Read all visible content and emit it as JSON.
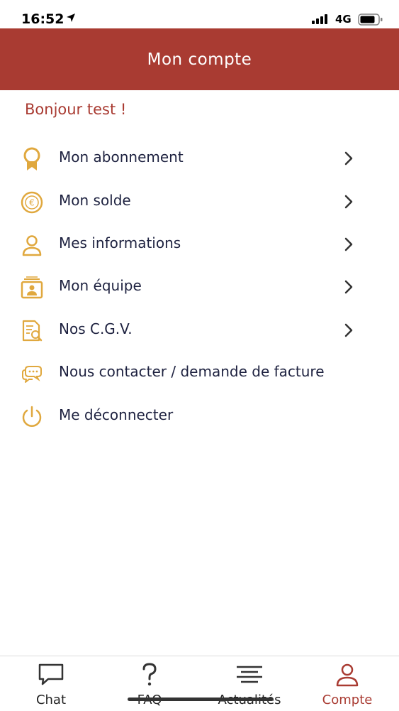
{
  "status_bar": {
    "time": "16:52",
    "network": "4G"
  },
  "header": {
    "title": "Mon compte"
  },
  "greeting": "Bonjour test !",
  "colors": {
    "brand": "#a93b32",
    "icon_gold": "#e0a83e",
    "text_dark": "#1e2240"
  },
  "menu": [
    {
      "label": "Mon abonnement",
      "icon": "ribbon-badge-icon",
      "has_chevron": true
    },
    {
      "label": "Mon solde",
      "icon": "euro-coin-icon",
      "has_chevron": true
    },
    {
      "label": "Mes informations",
      "icon": "user-icon",
      "has_chevron": true
    },
    {
      "label": "Mon équipe",
      "icon": "team-id-card-icon",
      "has_chevron": true
    },
    {
      "label": "Nos C.G.V.",
      "icon": "document-search-icon",
      "has_chevron": true
    },
    {
      "label": "Nous contacter / demande de facture",
      "icon": "chat-bubbles-icon",
      "has_chevron": false
    },
    {
      "label": "Me déconnecter",
      "icon": "power-icon",
      "has_chevron": false
    }
  ],
  "tabbar": [
    {
      "label": "Chat",
      "icon": "chat-icon",
      "active": false
    },
    {
      "label": "FAQ",
      "icon": "question-icon",
      "active": false
    },
    {
      "label": "Actualités",
      "icon": "lines-icon",
      "active": false
    },
    {
      "label": "Compte",
      "icon": "user-icon",
      "active": true
    }
  ]
}
